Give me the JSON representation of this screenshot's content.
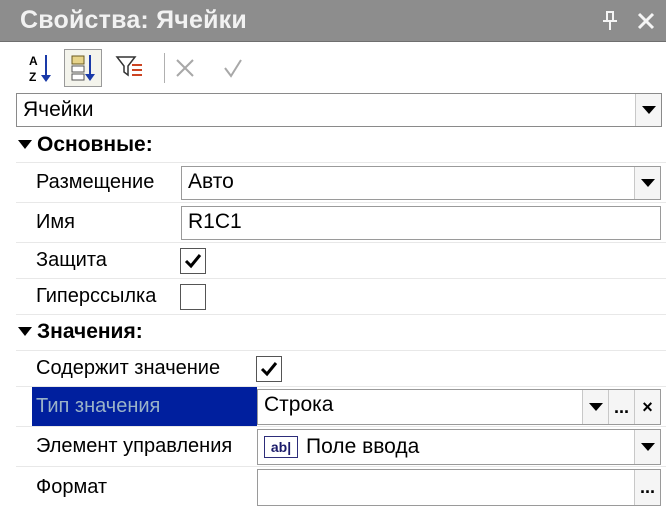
{
  "window": {
    "title": "Свойства: Ячейки",
    "pin_icon": "pin-icon",
    "close_icon": "close-icon"
  },
  "toolbar": {
    "sort_alpha_icon": "sort-alphabetical-icon",
    "sort_category_icon": "sort-by-category-icon",
    "filter_icon": "filter-properties-icon",
    "cancel_icon": "cancel-x-icon",
    "apply_icon": "apply-check-icon"
  },
  "object_selector": {
    "value": "Ячейки"
  },
  "groups": {
    "main": {
      "label": "Основные:",
      "props": {
        "placement": {
          "label": "Размещение",
          "value": "Авто"
        },
        "name": {
          "label": "Имя",
          "value": "R1C1"
        },
        "protection": {
          "label": "Защита",
          "checked": true
        },
        "hyperlink": {
          "label": "Гиперссылка",
          "checked": false
        }
      }
    },
    "values": {
      "label": "Значения:",
      "props": {
        "contains_value": {
          "label": "Содержит значение",
          "checked": true
        },
        "value_type": {
          "label": "Тип значения",
          "value": "Строка",
          "select_btn": "...",
          "clear_btn": "×"
        },
        "control_element": {
          "label": "Элемент управления",
          "icon_text": "ab|",
          "value": "Поле ввода"
        },
        "format": {
          "label": "Формат",
          "value": "",
          "select_btn": "..."
        }
      }
    }
  },
  "colors": {
    "titlebar": "#8d8d8d",
    "selection": "#001f9e",
    "selection_text": "#9ab3c8"
  }
}
